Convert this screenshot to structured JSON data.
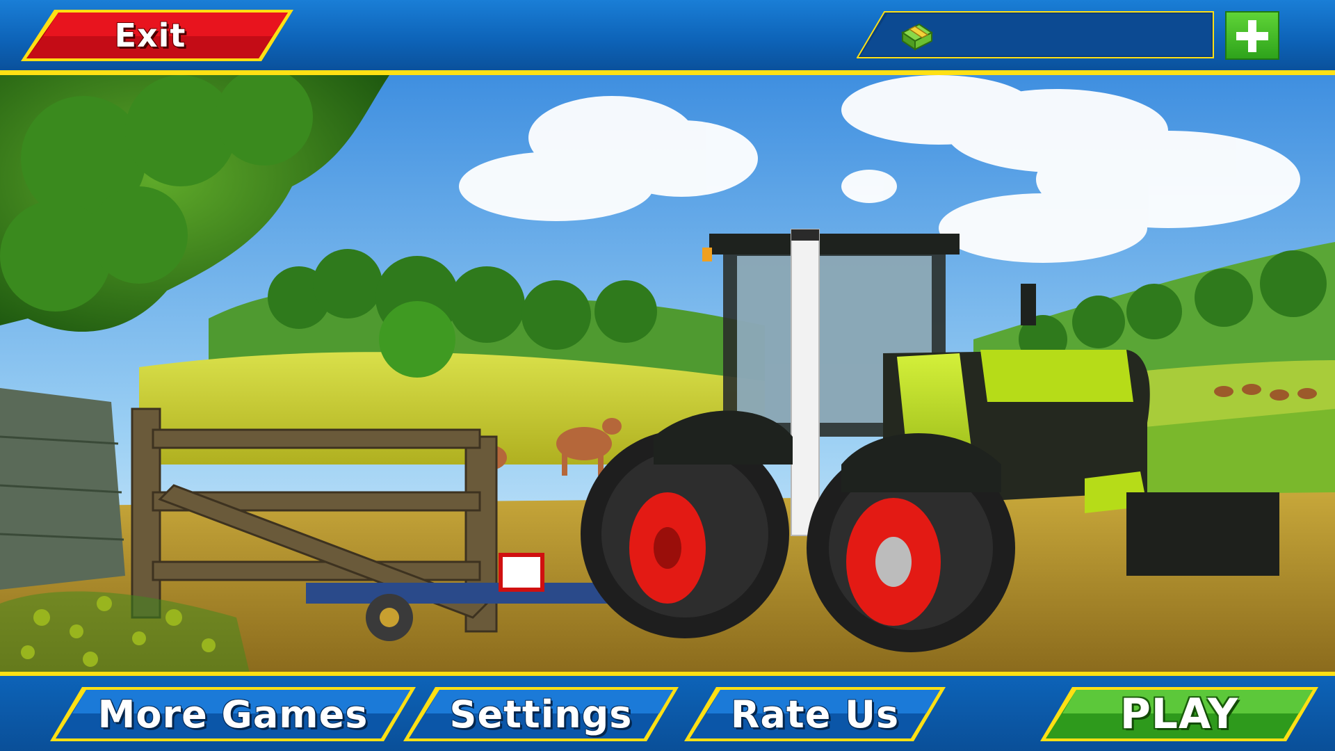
{
  "topbar": {
    "exit_label": "Exit",
    "cash": {
      "icon": "cash-bundle-icon",
      "value": ""
    },
    "add_cash_icon": "plus-icon"
  },
  "menu": {
    "more_games_label": "More Games",
    "settings_label": "Settings",
    "rate_us_label": "Rate Us",
    "play_label": "PLAY"
  },
  "colors": {
    "bar_blue": "#0d63b8",
    "accent_yellow": "#ffe014",
    "exit_red": "#d0101a",
    "play_green": "#3cb82a",
    "tractor_green": "#b6dc18",
    "wheel_red": "#e31a14"
  }
}
